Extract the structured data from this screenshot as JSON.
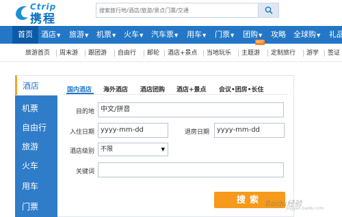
{
  "header": {
    "logo_en": "Ctrip",
    "logo_cn": "携程",
    "search_placeholder": "搜索旅行地/酒店/旅游/景点门票/交通"
  },
  "nav": {
    "items": [
      {
        "label": "首页"
      },
      {
        "label": "酒店",
        "has_caret": true
      },
      {
        "label": "旅游",
        "has_caret": true
      },
      {
        "label": "机票",
        "has_caret": true
      },
      {
        "label": "火车",
        "has_caret": true
      },
      {
        "label": "汽车票",
        "has_caret": true
      },
      {
        "label": "用车",
        "has_caret": true
      },
      {
        "label": "门票",
        "has_caret": true
      },
      {
        "label": "团购",
        "has_caret": true
      },
      {
        "label": "攻略"
      },
      {
        "label": "全球购",
        "has_caret": true
      },
      {
        "label": "礼品"
      }
    ],
    "caret": "▼",
    "active_index": 0,
    "colors": {
      "bar": "#2377c6",
      "active": "#0b5aa6"
    }
  },
  "subnav": {
    "items": [
      "旅游首页",
      "周末游",
      "跟团游",
      "自由行",
      "邮轮",
      "酒店+景点",
      "当地玩乐",
      "主题游",
      "定制旅行",
      "游学",
      "签证"
    ],
    "hot_badge": "HOT"
  },
  "leftmenu": {
    "active_label": "酒店",
    "items": [
      "机票",
      "自由行",
      "旅游",
      "火车",
      "用车",
      "门票"
    ],
    "colors": {
      "bg": "#2f7cc9",
      "active_border": "#f5a623"
    }
  },
  "tabs": {
    "items": [
      "国内酒店",
      "海外酒店",
      "酒店团购",
      "酒店+景点",
      "会议•团房•长住"
    ],
    "active_index": 0
  },
  "form": {
    "destination_label": "目的地",
    "destination_value": "中文/拼音",
    "checkin_label": "入住日期",
    "checkin_value": "yyyy-mm-dd",
    "checkout_label": "退房日期",
    "checkout_value": "yyyy-mm-dd",
    "level_label": "酒店级别",
    "level_value": "不限",
    "keyword_label": "关键词",
    "keyword_value": "",
    "submit_label": "搜索",
    "submit_color": "#f59a1b"
  },
  "watermark": {
    "text": "Baidu经验",
    "sub": "jingyan.baidu.com"
  }
}
